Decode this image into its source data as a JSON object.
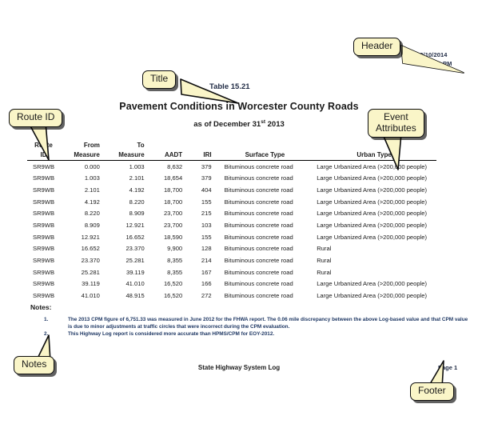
{
  "document": {
    "header_date": "03/10/2014",
    "header_time": "03:22:12 PM",
    "table_number": "Table 15.21",
    "title": "Pavement Conditions in Worcester County Roads",
    "subtitle_prefix": "as of December 31",
    "subtitle_sup": "st",
    "subtitle_suffix": " 2013"
  },
  "table": {
    "columns": [
      {
        "key": "route",
        "label": "Route\nID"
      },
      {
        "key": "from",
        "label": "From\nMeasure"
      },
      {
        "key": "to",
        "label": "To\nMeasure"
      },
      {
        "key": "aadt",
        "label": "AADT"
      },
      {
        "key": "iri",
        "label": "IRI"
      },
      {
        "key": "surface",
        "label": "Surface Type"
      },
      {
        "key": "urban",
        "label": "Urban  Type"
      }
    ],
    "rows": [
      {
        "route": "SR9WB",
        "from": "0.000",
        "to": "1.003",
        "aadt": "8,632",
        "iri": "379",
        "surface": "Bituminous concrete road",
        "urban": "Large Urbanized Area (>200,000 people)"
      },
      {
        "route": "SR9WB",
        "from": "1.003",
        "to": "2.101",
        "aadt": "18,654",
        "iri": "379",
        "surface": "Bituminous concrete road",
        "urban": "Large Urbanized Area (>200,000 people)"
      },
      {
        "route": "SR9WB",
        "from": "2.101",
        "to": "4.192",
        "aadt": "18,700",
        "iri": "404",
        "surface": "Bituminous concrete road",
        "urban": "Large Urbanized Area (>200,000 people)"
      },
      {
        "route": "SR9WB",
        "from": "4.192",
        "to": "8.220",
        "aadt": "18,700",
        "iri": "155",
        "surface": "Bituminous concrete road",
        "urban": "Large Urbanized Area (>200,000 people)"
      },
      {
        "route": "SR9WB",
        "from": "8.220",
        "to": "8.909",
        "aadt": "23,700",
        "iri": "215",
        "surface": "Bituminous concrete road",
        "urban": "Large Urbanized Area (>200,000 people)"
      },
      {
        "route": "SR9WB",
        "from": "8.909",
        "to": "12.921",
        "aadt": "23,700",
        "iri": "103",
        "surface": "Bituminous concrete road",
        "urban": "Large Urbanized Area (>200,000 people)"
      },
      {
        "route": "SR9WB",
        "from": "12.921",
        "to": "16.652",
        "aadt": "18,590",
        "iri": "155",
        "surface": "Bituminous concrete road",
        "urban": "Large Urbanized Area (>200,000 people)"
      },
      {
        "route": "SR9WB",
        "from": "16.652",
        "to": "23.370",
        "aadt": "9,900",
        "iri": "128",
        "surface": "Bituminous concrete road",
        "urban": "Rural"
      },
      {
        "route": "SR9WB",
        "from": "23.370",
        "to": "25.281",
        "aadt": "8,355",
        "iri": "214",
        "surface": "Bituminous concrete road",
        "urban": "Rural"
      },
      {
        "route": "SR9WB",
        "from": "25.281",
        "to": "39.119",
        "aadt": "8,355",
        "iri": "167",
        "surface": "Bituminous concrete road",
        "urban": "Rural"
      },
      {
        "route": "SR9WB",
        "from": "39.119",
        "to": "41.010",
        "aadt": "16,520",
        "iri": "166",
        "surface": "Bituminous concrete road",
        "urban": "Large Urbanized Area (>200,000 people)"
      },
      {
        "route": "SR9WB",
        "from": "41.010",
        "to": "48.915",
        "aadt": "16,520",
        "iri": "272",
        "surface": "Bituminous concrete road",
        "urban": "Large Urbanized Area (>200,000 people)"
      }
    ]
  },
  "notes": {
    "label": "Notes:",
    "items": [
      {
        "number": "1.",
        "text": "The 2013 CPM figure of 6,751.33 was measured in June 2012 for the FHWA report. The 0.06 mile discrepancy between the above Log-based value and that CPM value is due to minor  adjustments at traffic circles that were incorrect during the CPM evaluation."
      },
      {
        "number": "2.",
        "text": "This Highway Log report is considered more accurate than HPMS/CPM for EOY-2012."
      }
    ]
  },
  "footer": {
    "center_text": "State Highway System Log",
    "page_label": "Page 1"
  },
  "callouts": {
    "header": "Header",
    "title": "Title",
    "route_id": "Route ID",
    "event_attributes": "Event\nAttributes",
    "notes": "Notes",
    "footer": "Footer"
  },
  "colors": {
    "callout_fill": "#faf5c8",
    "callout_border": "#0d0d0d",
    "note_text": "#1f3864",
    "body_text": "#1a1a1a"
  }
}
